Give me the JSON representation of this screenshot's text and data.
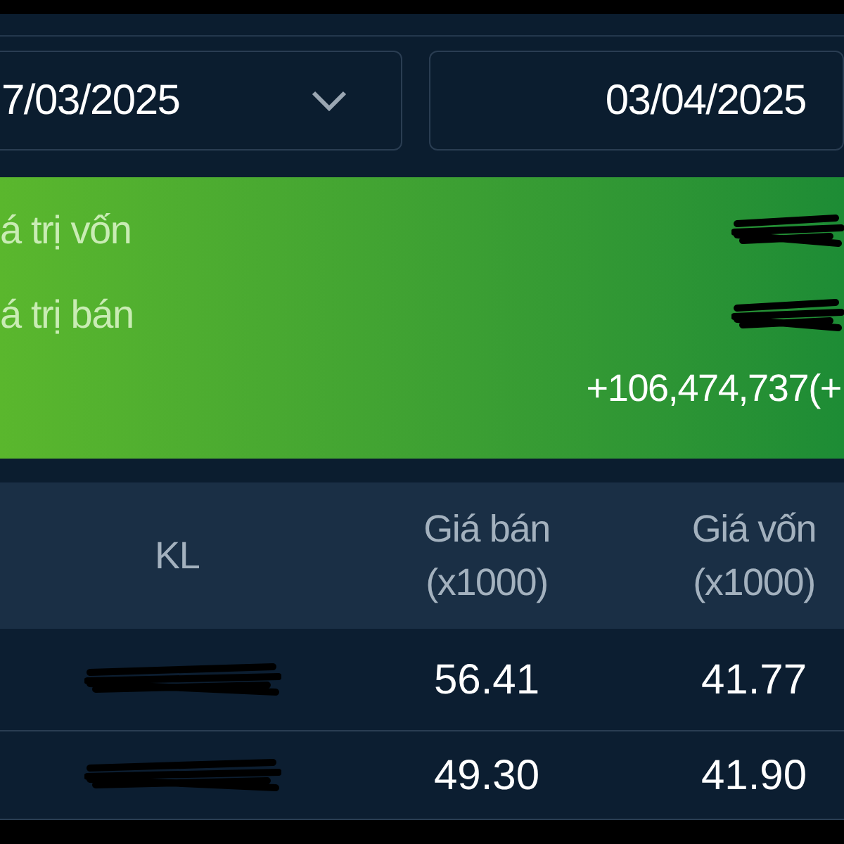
{
  "date_range": {
    "from": "7/03/2025",
    "to": "03/04/2025"
  },
  "summary": {
    "rows": [
      {
        "label": "á trị vốn",
        "redacted": true
      },
      {
        "label": "á trị bán",
        "redacted": true
      }
    ],
    "profit": "+106,474,737(+"
  },
  "table": {
    "columns": [
      {
        "lines": [
          "KL"
        ]
      },
      {
        "lines": [
          "Giá bán",
          "(x1000)"
        ]
      },
      {
        "lines": [
          "Giá vốn",
          "(x1000)"
        ]
      }
    ],
    "rows": [
      {
        "kl_redacted": true,
        "sell_price": "56.41",
        "cost_price": "41.77"
      },
      {
        "kl_redacted": true,
        "sell_price": "49.30",
        "cost_price": "41.90"
      }
    ]
  }
}
